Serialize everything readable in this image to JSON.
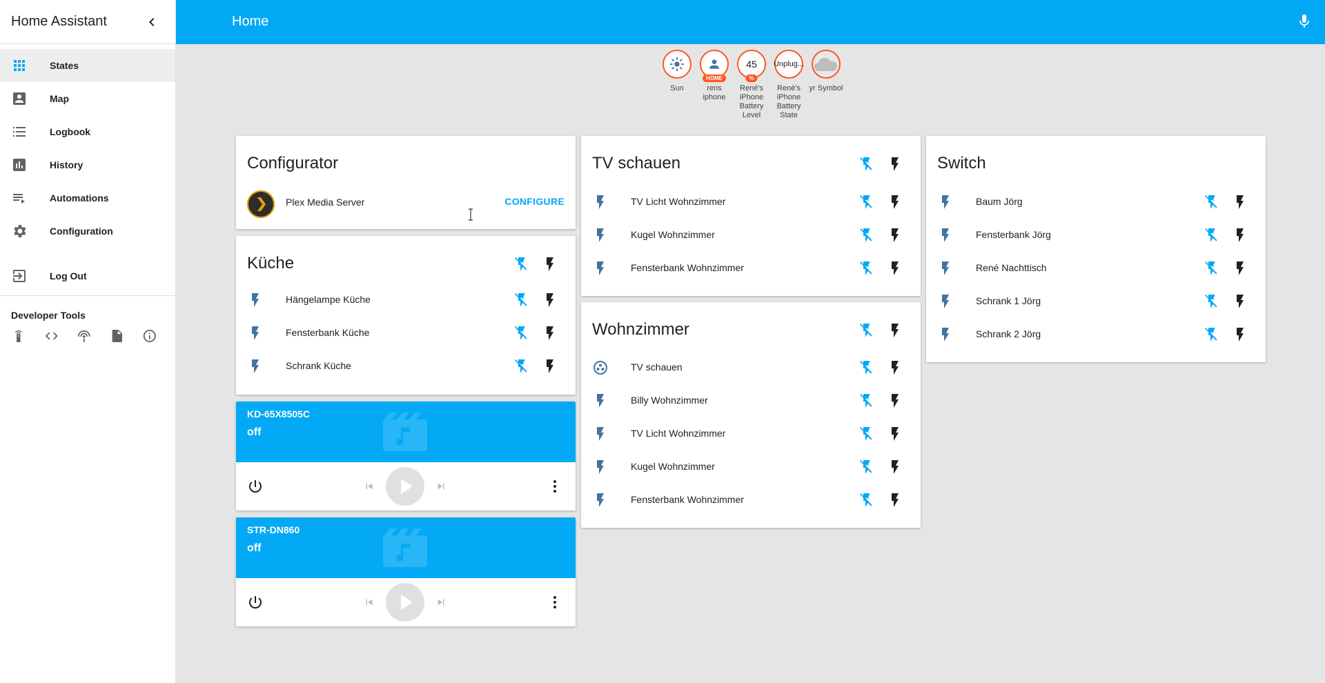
{
  "sidebar": {
    "title": "Home Assistant",
    "items": [
      {
        "label": "States",
        "icon": "apps-icon",
        "active": true
      },
      {
        "label": "Map",
        "icon": "account-box-icon"
      },
      {
        "label": "Logbook",
        "icon": "format-list-bulleted-icon"
      },
      {
        "label": "History",
        "icon": "chart-box-icon"
      },
      {
        "label": "Automations",
        "icon": "playlist-play-icon"
      },
      {
        "label": "Configuration",
        "icon": "settings-icon"
      }
    ],
    "logout_label": "Log Out",
    "dev_tools_title": "Developer Tools",
    "dev_tools": [
      "remote-icon",
      "code-tags-icon",
      "access-point-icon",
      "file-xml-icon",
      "information-outline-icon"
    ]
  },
  "header": {
    "title": "Home"
  },
  "badges": [
    {
      "value": "",
      "label": "Sun",
      "icon": "sun-icon"
    },
    {
      "value": "",
      "label": "rens iphone",
      "tag": "HOME",
      "icon": "account-icon"
    },
    {
      "value": "45",
      "label": "René's iPhone Battery Level",
      "tag": "%"
    },
    {
      "value": "Unplug...",
      "label": "René's iPhone Battery State"
    },
    {
      "value": "",
      "label": "yr Symbol",
      "icon": "cloud-icon"
    }
  ],
  "configurator": {
    "title": "Configurator",
    "entity": "Plex Media Server",
    "action": "CONFIGURE"
  },
  "kueche": {
    "title": "Küche",
    "entities": [
      "Hängelampe Küche",
      "Fensterbank Küche",
      "Schrank Küche"
    ]
  },
  "media": [
    {
      "name": "KD-65X8505C",
      "state": "off"
    },
    {
      "name": "STR-DN860",
      "state": "off"
    }
  ],
  "tv_schauen": {
    "title": "TV schauen",
    "entities": [
      "TV Licht Wohnzimmer",
      "Kugel Wohnzimmer",
      "Fensterbank Wohnzimmer"
    ]
  },
  "wohnzimmer": {
    "title": "Wohnzimmer",
    "entities": [
      "TV schauen",
      "Billy Wohnzimmer",
      "TV Licht Wohnzimmer",
      "Kugel Wohnzimmer",
      "Fensterbank Wohnzimmer"
    ]
  },
  "switch": {
    "title": "Switch",
    "entities": [
      "Baum Jörg",
      "Fensterbank Jörg",
      "René Nachttisch",
      "Schrank 1 Jörg",
      "Schrank 2 Jörg"
    ]
  },
  "colors": {
    "primary": "#03a9f4",
    "badge_border": "#ff5722",
    "entity_icon": "#44739e",
    "toggle_off": "#03a9f4",
    "toggle_on": "#212121"
  }
}
